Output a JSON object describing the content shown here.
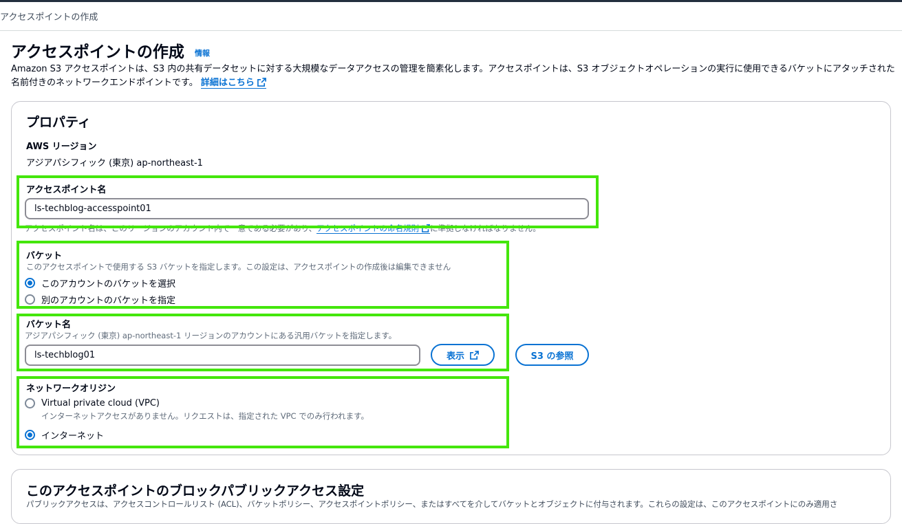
{
  "breadcrumb": "アクセスポイントの作成",
  "page": {
    "title": "アクセスポイントの作成",
    "info_link": "情報",
    "description": "Amazon S3 アクセスポイントは、S3 内の共有データセットに対する大規模なデータアクセスの管理を簡素化します。アクセスポイントは、S3 オブジェクトオペレーションの実行に使用できるバケットにアタッチされた名前付きのネットワークエンドポイントです。",
    "learn_more": "詳細はこちら"
  },
  "properties": {
    "title": "プロパティ",
    "region_label": "AWS リージョン",
    "region_value": "アジアパシフィック (東京) ap-northeast-1",
    "ap_name_label": "アクセスポイント名",
    "ap_name_value": "ls-techblog-accesspoint01",
    "ap_name_hint_before": "アクセスポイント名は、このリージョンのアカウント内で一意である必要があり、",
    "ap_name_hint_link": "アクセスポイントの命名規則",
    "ap_name_hint_after": "に準拠しなければなりません。",
    "bucket_label": "バケット",
    "bucket_desc": "このアクセスポイントで使用する S3 バケットを指定します。この設定は、アクセスポイントの作成後は編集できません",
    "bucket_options": [
      {
        "label": "このアカウントのバケットを選択",
        "checked": true
      },
      {
        "label": "別のアカウントのバケットを指定",
        "checked": false
      }
    ],
    "bucket_name_label": "バケット名",
    "bucket_name_desc": "アジアパシフィック (東京) ap-northeast-1 リージョンのアカウントにある汎用バケットを指定します。",
    "bucket_name_value": "ls-techblog01",
    "view_button": "表示",
    "browse_button": "S3 の参照",
    "network_label": "ネットワークオリジン",
    "network_options": [
      {
        "label": "Virtual private cloud (VPC)",
        "desc": "インターネットアクセスがありません。リクエストは、指定された VPC でのみ行われます。",
        "checked": false
      },
      {
        "label": "インターネット",
        "checked": true
      }
    ]
  },
  "block_public": {
    "title": "このアクセスポイントのブロックパブリックアクセス設定",
    "desc": "パブリックアクセスは、アクセスコントロールリスト (ACL)、バケットポリシー、アクセスポイントポリシー、またはすべてを介してバケットとオブジェクトに付与されます。これらの設定は、このアクセスポイントにのみ適用さ"
  },
  "colors": {
    "accent": "#0972d3",
    "highlight": "#44e60c",
    "text": "#000716"
  }
}
